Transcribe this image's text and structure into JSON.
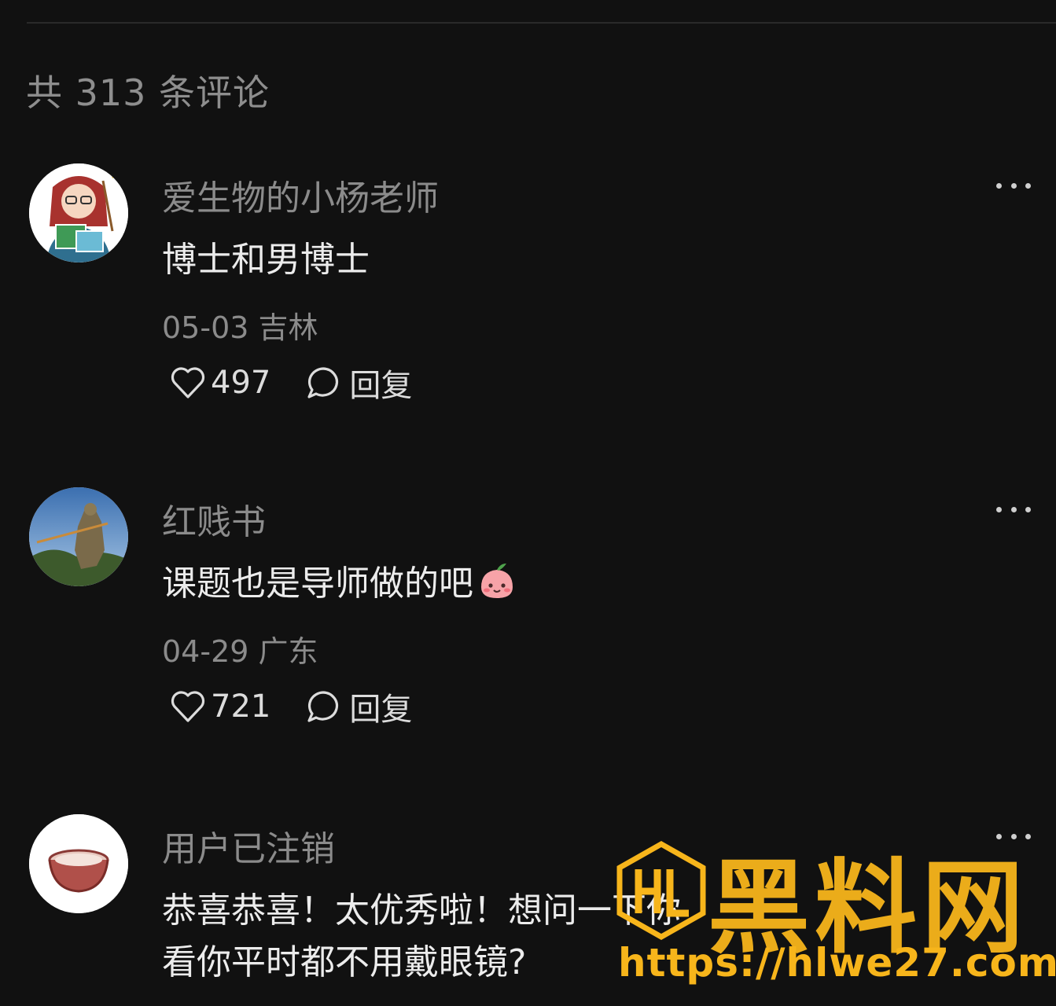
{
  "header": {
    "count_text": "共 313 条评论"
  },
  "comments": [
    {
      "user": "爱生物的小杨老师",
      "text": "博士和男博士",
      "date": "05-03",
      "location": "吉林",
      "likes": "497",
      "reply_label": "回复",
      "avatar_icon": "teacher-avatar"
    },
    {
      "user": "红贱书",
      "text": "课题也是导师做的吧",
      "emoji": "peach-face-emoji",
      "date": "04-29",
      "location": "广东",
      "likes": "721",
      "reply_label": "回复",
      "avatar_icon": "statue-avatar"
    },
    {
      "user": "用户已注销",
      "text": "恭喜恭喜！太优秀啦！想问一下你",
      "text_line2": "看你平时都不用戴眼镜?",
      "avatar_icon": "bowl-avatar"
    }
  ],
  "watermark": {
    "brand": "黑料网",
    "url": "https://hlwe27.com",
    "color": "#f7b51b"
  }
}
